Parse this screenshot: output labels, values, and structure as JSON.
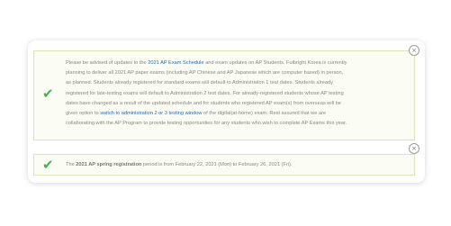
{
  "notice_1": {
    "lines": [
      {
        "parts": [
          {
            "text": "Please be advised of updates to the "
          },
          {
            "text": "2021 AP Exam Schedule",
            "link": true
          },
          {
            "text": " and exam updates on AP Students. Fulbright Korea is currently"
          }
        ]
      },
      {
        "parts": [
          {
            "text": "planning to deliver all 2021 AP paper exams (including AP Chinese and AP Japanese which are computer based) in person,"
          }
        ]
      },
      {
        "parts": [
          {
            "text": "as planned. Students already registered for standard exams will default to Administration 1 test dates. Students already"
          }
        ]
      },
      {
        "parts": [
          {
            "text": "registered for late-testing exams will default to Administration 2 test dates. For already-registered students whose AP testing"
          }
        ]
      },
      {
        "parts": [
          {
            "text": "dates have changed as a result of the updated schedule and for students who registered AP exam(s) from overseas will be"
          }
        ]
      },
      {
        "parts": [
          {
            "text": "given option to "
          },
          {
            "text": "switch to administration 2 or 3 testing window",
            "link": true
          },
          {
            "text": " of the digital(at-home) exam.  Rest assured that we are"
          }
        ]
      },
      {
        "parts": [
          {
            "text": "collaborating with the AP Program to provide testing opportunities for any students who wish to complete AP Exams this year."
          }
        ]
      }
    ]
  },
  "notice_2": {
    "lines": [
      {
        "parts": [
          {
            "text": "The "
          },
          {
            "text": "2021 AP spring registration",
            "bold": true
          },
          {
            "text": " period is from February 22, 2021 (Mon) to February 26, 2021 (Fri)."
          }
        ]
      }
    ]
  },
  "icons": {
    "check": "✔",
    "close": "×"
  },
  "colors": {
    "check": "#4caf50",
    "link": "#2e6db4",
    "alert_border": "#dfe3b8",
    "alert_background": "#fbfcf3",
    "text": "#888888"
  }
}
